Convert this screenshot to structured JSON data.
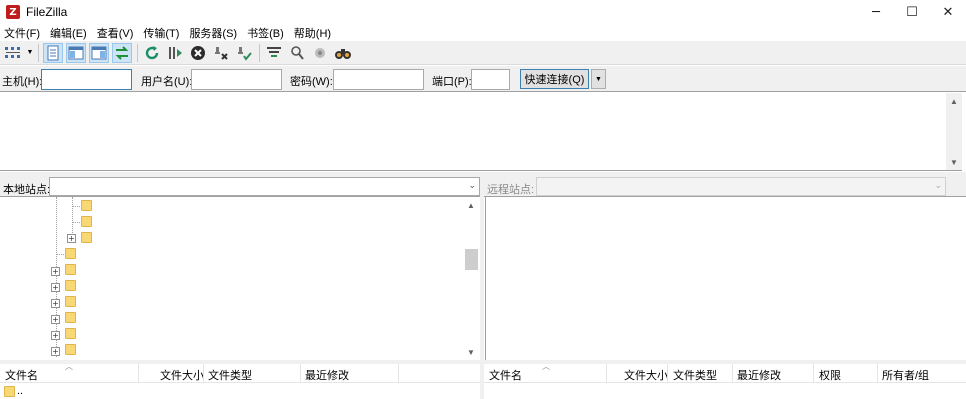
{
  "window": {
    "title": "FileZilla",
    "app_icon_glyph": "Z",
    "controls": {
      "minimize": "─",
      "maximize": "☐",
      "close": "✕"
    }
  },
  "menu": [
    "文件(F)",
    "编辑(E)",
    "查看(V)",
    "传输(T)",
    "服务器(S)",
    "书签(B)",
    "帮助(H)"
  ],
  "toolbar": {
    "icons": [
      "site-manager-icon",
      "toggle-message-log-icon",
      "toggle-local-tree-icon",
      "toggle-remote-tree-icon",
      "toggle-transfer-queue-icon",
      "refresh-icon",
      "process-queue-icon",
      "cancel-icon",
      "disconnect-icon",
      "reconnect-icon",
      "directory-filter-icon",
      "search-remote-icon",
      "compare-dirs-icon",
      "find-files-icon"
    ]
  },
  "quickconnect": {
    "host_label": "主机(H):",
    "user_label": "用户名(U):",
    "password_label": "密码(W):",
    "port_label": "端口(P):",
    "host_value": "",
    "user_value": "",
    "password_value": "",
    "port_value": "",
    "connect_label": "快速连接(Q)",
    "dropdown_glyph": "▼"
  },
  "local": {
    "site_label": "本地站点:",
    "path_value": "",
    "list_columns": [
      "文件名",
      "文件大小",
      "文件类型",
      "最近修改"
    ],
    "parent_dir": ".."
  },
  "remote": {
    "site_label": "远程站点:",
    "path_value": "",
    "list_columns": [
      "文件名",
      "文件大小",
      "文件类型",
      "最近修改",
      "权限",
      "所有者/组"
    ]
  },
  "glyphs": {
    "chevron_down": "⌄",
    "scroll_up": "▲",
    "scroll_down": "▼",
    "sort_up": "︿",
    "plus": "+"
  },
  "colors": {
    "accent": "#3c7fb1",
    "folder": "#f8d775",
    "toolbar_bg": "#f0f0f0",
    "brand_red": "#bf1d1d"
  }
}
